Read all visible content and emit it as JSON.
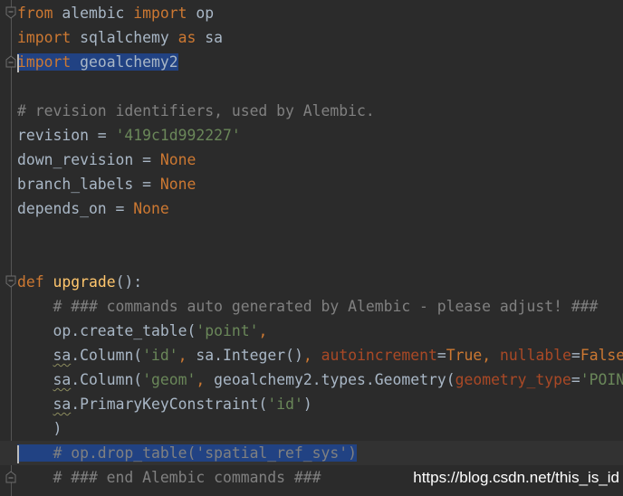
{
  "editor": {
    "lines": [
      {
        "tokens": [
          {
            "t": "from",
            "c": "kw"
          },
          {
            "t": " alembic ",
            "c": ""
          },
          {
            "t": "import",
            "c": "kw"
          },
          {
            "t": " op",
            "c": ""
          }
        ]
      },
      {
        "tokens": [
          {
            "t": "import",
            "c": "kw"
          },
          {
            "t": " sqlalchemy ",
            "c": ""
          },
          {
            "t": "as",
            "c": "kw"
          },
          {
            "t": " sa",
            "c": ""
          }
        ]
      },
      {
        "tokens": [
          {
            "t": "import",
            "c": "kw sel"
          },
          {
            "t": " geoalchemy2",
            "c": "sel"
          }
        ],
        "caret": true
      },
      {
        "tokens": []
      },
      {
        "tokens": [
          {
            "t": "# revision identifiers, used by Alembic.",
            "c": "cmt"
          }
        ]
      },
      {
        "tokens": [
          {
            "t": "revision = ",
            "c": ""
          },
          {
            "t": "'419c1d992227'",
            "c": "str"
          }
        ]
      },
      {
        "tokens": [
          {
            "t": "down_revision = ",
            "c": ""
          },
          {
            "t": "None",
            "c": "kw"
          }
        ]
      },
      {
        "tokens": [
          {
            "t": "branch_labels = ",
            "c": ""
          },
          {
            "t": "None",
            "c": "kw"
          }
        ]
      },
      {
        "tokens": [
          {
            "t": "depends_on = ",
            "c": ""
          },
          {
            "t": "None",
            "c": "kw"
          }
        ]
      },
      {
        "tokens": []
      },
      {
        "tokens": []
      },
      {
        "tokens": [
          {
            "t": "def",
            "c": "kw"
          },
          {
            "t": " ",
            "c": ""
          },
          {
            "t": "upgrade",
            "c": "fn"
          },
          {
            "t": "():",
            "c": ""
          }
        ]
      },
      {
        "tokens": [
          {
            "t": "    # ### commands auto generated by Alembic - please adjust! ###",
            "c": "cmt"
          }
        ]
      },
      {
        "tokens": [
          {
            "t": "    op.create_table(",
            "c": ""
          },
          {
            "t": "'point'",
            "c": "str"
          },
          {
            "t": ",",
            "c": "kw"
          }
        ]
      },
      {
        "tokens": [
          {
            "t": "    ",
            "c": ""
          },
          {
            "t": "sa",
            "c": "wavy"
          },
          {
            "t": ".Column(",
            "c": ""
          },
          {
            "t": "'id'",
            "c": "str"
          },
          {
            "t": ", ",
            "c": "kw"
          },
          {
            "t": "sa.Integer()",
            "c": ""
          },
          {
            "t": ", ",
            "c": "kw"
          },
          {
            "t": "autoincrement",
            "c": "named"
          },
          {
            "t": "=",
            "c": ""
          },
          {
            "t": "True",
            "c": "kw"
          },
          {
            "t": ", ",
            "c": "kw"
          },
          {
            "t": "nullable",
            "c": "named"
          },
          {
            "t": "=",
            "c": ""
          },
          {
            "t": "False",
            "c": "kw"
          }
        ]
      },
      {
        "tokens": [
          {
            "t": "    ",
            "c": ""
          },
          {
            "t": "sa",
            "c": "wavy"
          },
          {
            "t": ".Column(",
            "c": ""
          },
          {
            "t": "'geom'",
            "c": "str"
          },
          {
            "t": ", ",
            "c": "kw"
          },
          {
            "t": "geoalchemy2.types.Geometry(",
            "c": ""
          },
          {
            "t": "geometry_type",
            "c": "named"
          },
          {
            "t": "=",
            "c": ""
          },
          {
            "t": "'POINT'",
            "c": "str"
          }
        ]
      },
      {
        "tokens": [
          {
            "t": "    ",
            "c": ""
          },
          {
            "t": "sa",
            "c": "wavy"
          },
          {
            "t": ".PrimaryKeyConstraint(",
            "c": ""
          },
          {
            "t": "'id'",
            "c": "str"
          },
          {
            "t": ")",
            "c": ""
          }
        ]
      },
      {
        "tokens": [
          {
            "t": "    )",
            "c": ""
          }
        ]
      },
      {
        "tokens": [
          {
            "t": "    # op.drop_table('spatial_ref_sys')",
            "c": "cmt sel"
          }
        ],
        "caret": true,
        "current": true
      },
      {
        "tokens": [
          {
            "t": "    # ### end Alembic commands ###",
            "c": "cmt"
          }
        ]
      }
    ]
  },
  "watermark": "https://blog.csdn.net/this_is_id"
}
